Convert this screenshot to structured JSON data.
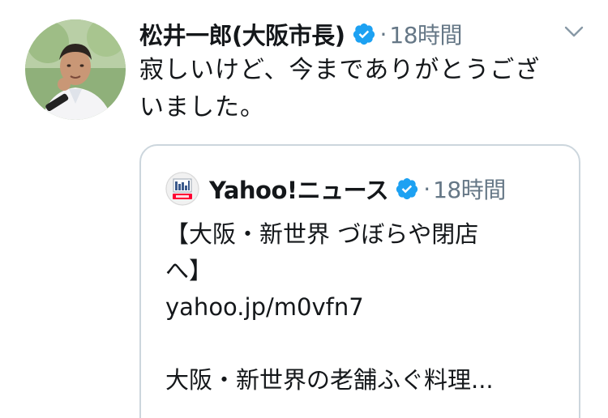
{
  "tweet": {
    "display_name": "松井一郎(大阪市長)",
    "time": "18時間",
    "separator": "·",
    "text_lines": [
      "寂しいけど、今までありがとうござ",
      "いました。"
    ]
  },
  "quoted": {
    "display_name": "Yahoo!ニュース",
    "time": "18時間",
    "separator": "·",
    "avatar_logo_text": "YAHOO! JAPAN",
    "body_lines": [
      "【大阪・新世界 づぼらや閉店",
      "へ】",
      "yahoo.jp/m0vfn7",
      "",
      "大阪・新世界の老舗ふぐ料理..."
    ]
  },
  "icons": {
    "verified": "verified-badge-icon",
    "caret": "chevron-down-icon"
  },
  "colors": {
    "text": "#14171a",
    "secondary": "#657786",
    "verified_blue": "#1da1f2",
    "border": "#ccd6dd"
  }
}
